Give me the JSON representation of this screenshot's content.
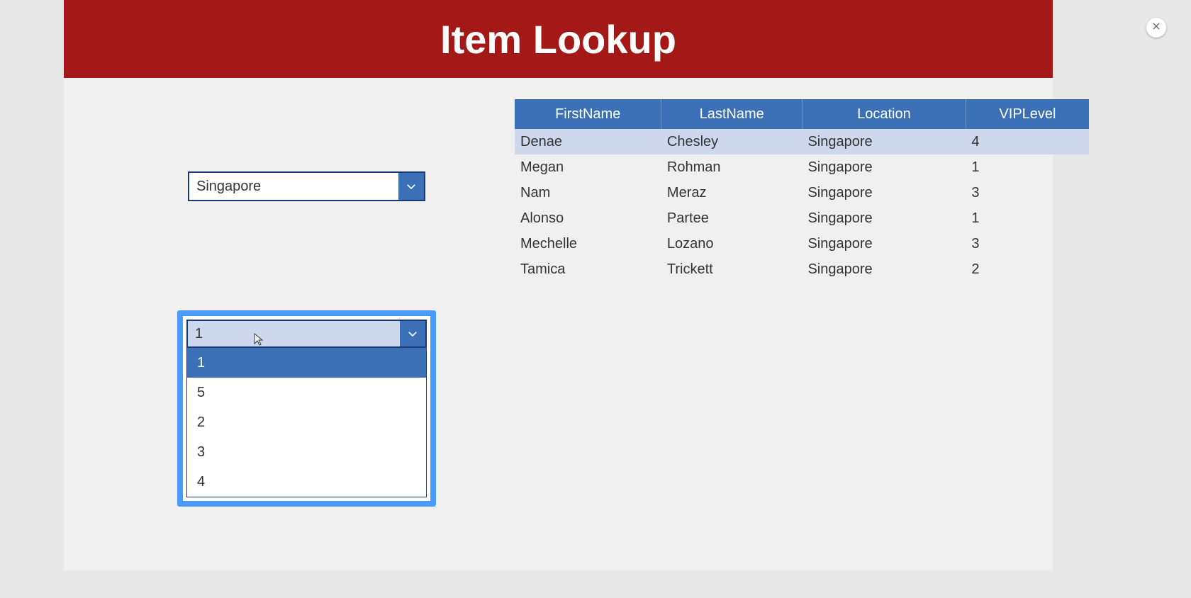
{
  "header": {
    "title": "Item Lookup"
  },
  "dropdown_location": {
    "value": "Singapore"
  },
  "dropdown_viplevel": {
    "value": "1",
    "options": [
      "1",
      "5",
      "2",
      "3",
      "4"
    ],
    "highlighted_index": 0
  },
  "table": {
    "columns": [
      "FirstName",
      "LastName",
      "Location",
      "VIPLevel"
    ],
    "rows": [
      {
        "FirstName": "Denae",
        "LastName": "Chesley",
        "Location": "Singapore",
        "VIPLevel": "4",
        "selected": true
      },
      {
        "FirstName": "Megan",
        "LastName": "Rohman",
        "Location": "Singapore",
        "VIPLevel": "1"
      },
      {
        "FirstName": "Nam",
        "LastName": "Meraz",
        "Location": "Singapore",
        "VIPLevel": "3"
      },
      {
        "FirstName": "Alonso",
        "LastName": "Partee",
        "Location": "Singapore",
        "VIPLevel": "1"
      },
      {
        "FirstName": "Mechelle",
        "LastName": "Lozano",
        "Location": "Singapore",
        "VIPLevel": "3"
      },
      {
        "FirstName": "Tamica",
        "LastName": "Trickett",
        "Location": "Singapore",
        "VIPLevel": "2"
      }
    ]
  }
}
